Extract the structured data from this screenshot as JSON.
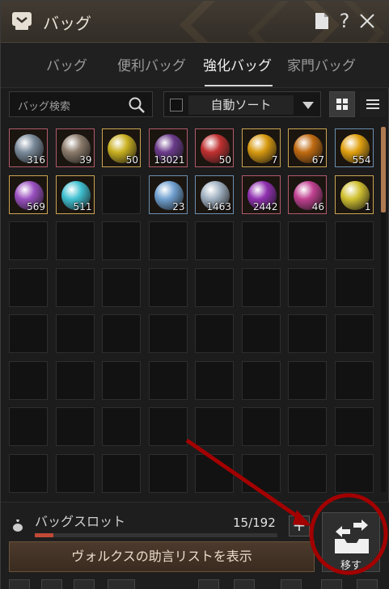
{
  "window": {
    "title": "バッグ"
  },
  "tabs": [
    {
      "label": "バッグ",
      "active": false
    },
    {
      "label": "便利バッグ",
      "active": false
    },
    {
      "label": "強化バッグ",
      "active": true
    },
    {
      "label": "家門バッグ",
      "active": false
    }
  ],
  "toolbar": {
    "search_placeholder": "バッグ検索",
    "sort_label": "自動ソート"
  },
  "items": [
    {
      "count": "316",
      "icon": "grey-stone-icon",
      "border": "pink",
      "color": "#7a8a9a"
    },
    {
      "count": "39",
      "icon": "dark-stone-icon",
      "border": "pink",
      "color": "#8a7a6a"
    },
    {
      "count": "50",
      "icon": "gold-crystal-icon",
      "border": "gold",
      "color": "#c9b020"
    },
    {
      "count": "13021",
      "icon": "purple-shard-icon",
      "border": "pink",
      "color": "#6a3a8a"
    },
    {
      "count": "50",
      "icon": "red-crystal-icon",
      "border": "pink",
      "color": "#c03030"
    },
    {
      "count": "7",
      "icon": "gold-stone-icon",
      "border": "gold",
      "color": "#d89a10"
    },
    {
      "count": "67",
      "icon": "ember-stone-icon",
      "border": "gold",
      "color": "#c06a10"
    },
    {
      "count": "554",
      "icon": "fire-drop-icon",
      "border": "blue",
      "color": "#e0a010"
    },
    {
      "count": "569",
      "icon": "violet-crystal-icon",
      "border": "gold",
      "color": "#9a50c0"
    },
    {
      "count": "511",
      "icon": "cyan-orb-icon",
      "border": "gold",
      "color": "#40c0d0"
    },
    {
      "count": "",
      "icon": "",
      "border": "none",
      "color": ""
    },
    {
      "count": "23",
      "icon": "blue-orb-icon",
      "border": "blue",
      "color": "#70a0d0"
    },
    {
      "count": "1463",
      "icon": "silver-stone-icon",
      "border": "blue",
      "color": "#a0b0c0"
    },
    {
      "count": "2442",
      "icon": "purple-orb-icon",
      "border": "pink",
      "color": "#9030b0"
    },
    {
      "count": "46",
      "icon": "galaxy-orb-icon",
      "border": "pink",
      "color": "#c04090"
    },
    {
      "count": "1",
      "icon": "yellow-orb-icon",
      "border": "gold",
      "color": "#d0c030"
    }
  ],
  "bag_slots": {
    "label": "バッグスロット",
    "count": "15/192",
    "fill_ratio": 0.078
  },
  "buttons": {
    "advice": "ヴォルクスの助言リストを表示",
    "move": "移す",
    "plus": "+"
  },
  "colors": {
    "accent": "#c04a35",
    "annotation": "#a00000"
  }
}
